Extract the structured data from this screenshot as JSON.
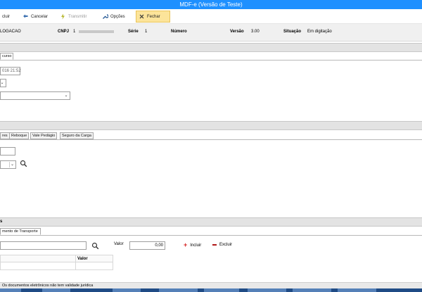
{
  "window": {
    "title": "MDF-e (Versão de Teste)"
  },
  "toolbar": {
    "incluir_label": "cluir",
    "cancelar_label": "Cancelar",
    "transmitir_label": "Transmitir",
    "opcoes_label": "Opções",
    "fechar_label": "Fechar"
  },
  "info": {
    "company": "LOGACAO",
    "cnpj_label": "CNPJ",
    "cnpj_value": "1",
    "serie_label": "Série",
    "serie_value": "1",
    "numero_label": "Número",
    "versao_label": "Versão",
    "versao_value": "3.00",
    "situacao_label": "Situação",
    "situacao_value": "Em digitação"
  },
  "section1": {
    "tab_label": "curso"
  },
  "form1": {
    "datetime_value": "016 21:52",
    "select_small_value": "",
    "select_wide_value": ""
  },
  "tabs2": [
    "res",
    "Reboque",
    "Vale Pedágio",
    "Seguro da Carga"
  ],
  "form2": {
    "input_value": "",
    "select_value": ""
  },
  "section3": {
    "title": "s",
    "tab_label": "mento de Transporte",
    "valor_label": "Valor",
    "valor_value": "0,00",
    "incluir_label": "Incluir",
    "excluir_label": "Excluir",
    "grid_header_valor": "Valor"
  },
  "status": {
    "text": "Os documentos eletrônicos não tem validade jurídica"
  },
  "colors": {
    "titlebar": "#1e90ff",
    "active_button": "#fce49a",
    "incluir_icon": "#d42020",
    "excluir_icon": "#b01818"
  },
  "icons": [
    "undo-icon",
    "lightning-icon",
    "wrench-icon",
    "close-icon",
    "search-icon",
    "plus-icon",
    "minus-icon"
  ]
}
